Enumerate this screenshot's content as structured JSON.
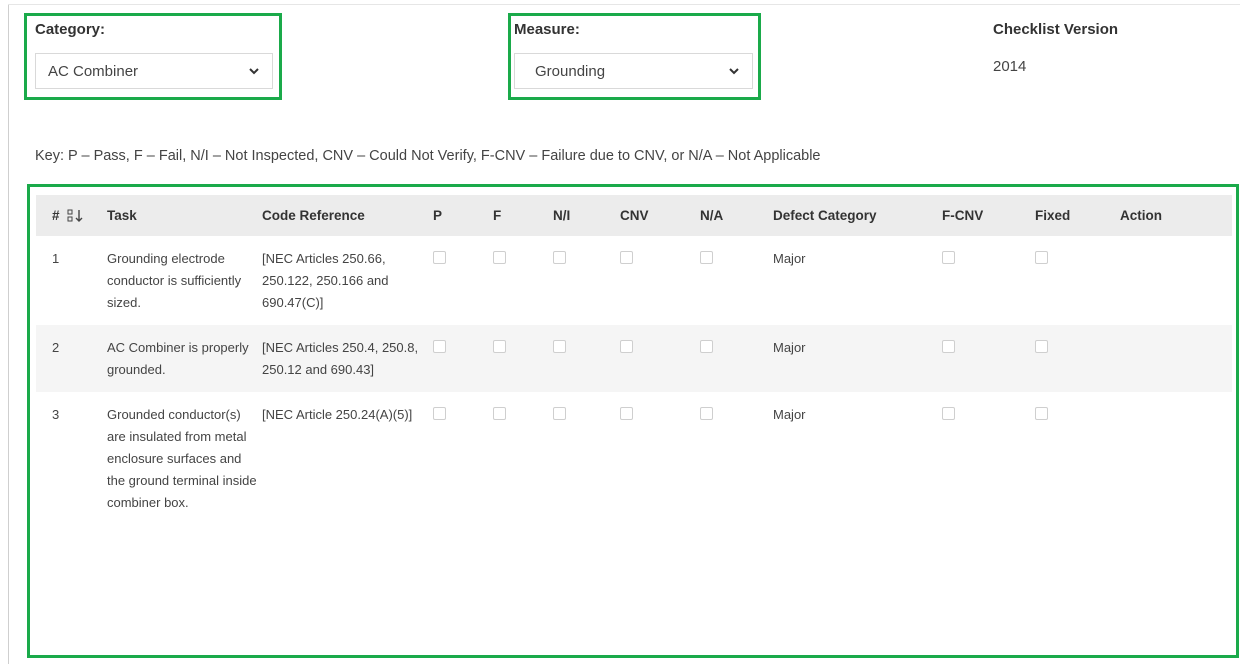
{
  "filters": {
    "category_label": "Category:",
    "category_value": "AC Combiner",
    "measure_label": "Measure:",
    "measure_value": "Grounding"
  },
  "checklist": {
    "version_label": "Checklist Version",
    "version_value": "2014"
  },
  "key_text": "Key: P – Pass, F – Fail, N/I – Not Inspected, CNV – Could Not Verify, F-CNV – Failure due to CNV, or N/A – Not Applicable",
  "table": {
    "headers": {
      "num": "#",
      "task": "Task",
      "code": "Code Reference",
      "p": "P",
      "f": "F",
      "ni": "N/I",
      "cnv": "CNV",
      "na": "N/A",
      "defect": "Defect Category",
      "fcnv": "F-CNV",
      "fixed": "Fixed",
      "action": "Action"
    },
    "rows": [
      {
        "num": "1",
        "task": "Grounding electrode conductor is sufficiently sized.",
        "code": "[NEC Articles 250.66, 250.122, 250.166 and 690.47(C)]",
        "defect": "Major"
      },
      {
        "num": "2",
        "task": "AC Combiner is properly grounded.",
        "code": "[NEC Articles 250.4, 250.8, 250.12 and 690.43]",
        "defect": "Major"
      },
      {
        "num": "3",
        "task": "Grounded conductor(s) are insulated from metal enclosure surfaces and the ground terminal inside combiner box.",
        "code": "[NEC Article 250.24(A)(5)]",
        "defect": "Major"
      }
    ]
  },
  "colors": {
    "highlight": "#1aaa4a",
    "header_bg": "#ececec",
    "stripe_bg": "#f5f5f5"
  },
  "icons": {
    "select_chevron": "chevron-down-icon",
    "sort": "sort-icon"
  }
}
